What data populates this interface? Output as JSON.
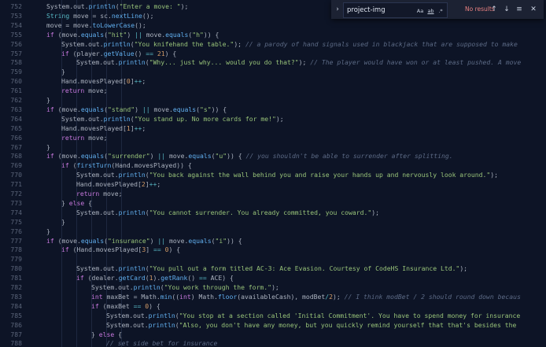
{
  "find_widget": {
    "toggle_icon": "chevron-right-icon",
    "query": "project-img",
    "options": [
      "Aa",
      "ab",
      ".*"
    ],
    "status": "No results",
    "prev_icon": "arrow-up-icon",
    "next_icon": "arrow-down-icon",
    "selection_icon": "lines-icon",
    "close_icon": "close-icon"
  },
  "colors": {
    "background": "#0d1426",
    "keyword": "#c678dd",
    "string": "#98c379",
    "comment": "#5c6a85",
    "number": "#d19a66",
    "function": "#61afef",
    "variable": "#e06c75",
    "type": "#56b6c2"
  },
  "lines": [
    {
      "n": "752",
      "indent": 2,
      "tokens": [
        [
          "p",
          "System.out."
        ],
        [
          "f",
          "println"
        ],
        [
          "p",
          "("
        ],
        [
          "s",
          "\"Enter a move: \""
        ],
        [
          "p",
          ");"
        ]
      ]
    },
    {
      "n": "753",
      "indent": 2,
      "tokens": [
        [
          "t",
          "String"
        ],
        [
          "p",
          " move = sc."
        ],
        [
          "f",
          "nextLine"
        ],
        [
          "p",
          "();"
        ]
      ]
    },
    {
      "n": "754",
      "indent": 2,
      "tokens": [
        [
          "p",
          "move = move."
        ],
        [
          "f",
          "toLowerCase"
        ],
        [
          "p",
          "();"
        ]
      ]
    },
    {
      "n": "755",
      "indent": 2,
      "tokens": [
        [
          "k",
          "if"
        ],
        [
          "p",
          " (move."
        ],
        [
          "f",
          "equals"
        ],
        [
          "p",
          "("
        ],
        [
          "s",
          "\"hit\""
        ],
        [
          "p",
          ") "
        ],
        [
          "o",
          "||"
        ],
        [
          "p",
          " move."
        ],
        [
          "f",
          "equals"
        ],
        [
          "p",
          "("
        ],
        [
          "s",
          "\"h\""
        ],
        [
          "p",
          ")) {"
        ]
      ]
    },
    {
      "n": "756",
      "indent": 3,
      "tokens": [
        [
          "p",
          "System.out."
        ],
        [
          "f",
          "println"
        ],
        [
          "p",
          "("
        ],
        [
          "s",
          "\"You knifehand the table.\""
        ],
        [
          "p",
          "); "
        ],
        [
          "c",
          "// a parody of hand signals used in blackjack that are supposed to make"
        ]
      ]
    },
    {
      "n": "757",
      "indent": 3,
      "tokens": [
        [
          "k",
          "if"
        ],
        [
          "p",
          " (player."
        ],
        [
          "f",
          "getValue"
        ],
        [
          "p",
          "() "
        ],
        [
          "o",
          "=="
        ],
        [
          "p",
          " "
        ],
        [
          "n",
          "21"
        ],
        [
          "p",
          ") {"
        ]
      ]
    },
    {
      "n": "758",
      "indent": 4,
      "tokens": [
        [
          "p",
          "System.out."
        ],
        [
          "f",
          "println"
        ],
        [
          "p",
          "("
        ],
        [
          "s",
          "\"Why... just why... would you do that?\""
        ],
        [
          "p",
          "); "
        ],
        [
          "c",
          "// The player would have won or at least pushed. A move"
        ]
      ]
    },
    {
      "n": "759",
      "indent": 3,
      "tokens": [
        [
          "p",
          "}"
        ]
      ]
    },
    {
      "n": "760",
      "indent": 3,
      "tokens": [
        [
          "p",
          "Hand.movesPlayed["
        ],
        [
          "n",
          "0"
        ],
        [
          "p",
          "]"
        ],
        [
          "o",
          "++"
        ],
        [
          "p",
          ";"
        ]
      ]
    },
    {
      "n": "761",
      "indent": 3,
      "tokens": [
        [
          "k",
          "return"
        ],
        [
          "p",
          " move;"
        ]
      ]
    },
    {
      "n": "762",
      "indent": 2,
      "tokens": [
        [
          "p",
          "}"
        ]
      ]
    },
    {
      "n": "763",
      "indent": 2,
      "tokens": [
        [
          "k",
          "if"
        ],
        [
          "p",
          " (move."
        ],
        [
          "f",
          "equals"
        ],
        [
          "p",
          "("
        ],
        [
          "s",
          "\"stand\""
        ],
        [
          "p",
          ") "
        ],
        [
          "o",
          "||"
        ],
        [
          "p",
          " move."
        ],
        [
          "f",
          "equals"
        ],
        [
          "p",
          "("
        ],
        [
          "s",
          "\"s\""
        ],
        [
          "p",
          ")) {"
        ]
      ]
    },
    {
      "n": "764",
      "indent": 3,
      "tokens": [
        [
          "p",
          "System.out."
        ],
        [
          "f",
          "println"
        ],
        [
          "p",
          "("
        ],
        [
          "s",
          "\"You stand up. No more cards for me!\""
        ],
        [
          "p",
          ");"
        ]
      ]
    },
    {
      "n": "765",
      "indent": 3,
      "tokens": [
        [
          "p",
          "Hand.movesPlayed["
        ],
        [
          "n",
          "1"
        ],
        [
          "p",
          "]"
        ],
        [
          "o",
          "++"
        ],
        [
          "p",
          ";"
        ]
      ]
    },
    {
      "n": "766",
      "indent": 3,
      "tokens": [
        [
          "k",
          "return"
        ],
        [
          "p",
          " move;"
        ]
      ]
    },
    {
      "n": "767",
      "indent": 2,
      "tokens": [
        [
          "p",
          "}"
        ]
      ]
    },
    {
      "n": "768",
      "indent": 2,
      "tokens": [
        [
          "k",
          "if"
        ],
        [
          "p",
          " (move."
        ],
        [
          "f",
          "equals"
        ],
        [
          "p",
          "("
        ],
        [
          "s",
          "\"surrender\""
        ],
        [
          "p",
          ") "
        ],
        [
          "o",
          "||"
        ],
        [
          "p",
          " move."
        ],
        [
          "f",
          "equals"
        ],
        [
          "p",
          "("
        ],
        [
          "s",
          "\"u\""
        ],
        [
          "p",
          ")) { "
        ],
        [
          "c",
          "// you shouldn't be able to surrender after splitting."
        ]
      ]
    },
    {
      "n": "769",
      "indent": 3,
      "tokens": [
        [
          "k",
          "if"
        ],
        [
          "p",
          " ("
        ],
        [
          "f",
          "firstTurn"
        ],
        [
          "p",
          "(Hand.movesPlayed)) {"
        ]
      ]
    },
    {
      "n": "770",
      "indent": 4,
      "tokens": [
        [
          "p",
          "System.out."
        ],
        [
          "f",
          "println"
        ],
        [
          "p",
          "("
        ],
        [
          "s",
          "\"You back against the wall behind you and raise your hands up and nervously look around.\""
        ],
        [
          "p",
          ");"
        ]
      ]
    },
    {
      "n": "771",
      "indent": 4,
      "tokens": [
        [
          "p",
          "Hand.movesPlayed["
        ],
        [
          "n",
          "2"
        ],
        [
          "p",
          "]"
        ],
        [
          "o",
          "++"
        ],
        [
          "p",
          ";"
        ]
      ]
    },
    {
      "n": "772",
      "indent": 4,
      "tokens": [
        [
          "k",
          "return"
        ],
        [
          "p",
          " move;"
        ]
      ]
    },
    {
      "n": "773",
      "indent": 3,
      "tokens": [
        [
          "p",
          "} "
        ],
        [
          "k",
          "else"
        ],
        [
          "p",
          " {"
        ]
      ]
    },
    {
      "n": "774",
      "indent": 4,
      "tokens": [
        [
          "p",
          "System.out."
        ],
        [
          "f",
          "println"
        ],
        [
          "p",
          "("
        ],
        [
          "s",
          "\"You cannot surrender. You already committed, you coward.\""
        ],
        [
          "p",
          ");"
        ]
      ]
    },
    {
      "n": "775",
      "indent": 3,
      "tokens": [
        [
          "p",
          "}"
        ]
      ]
    },
    {
      "n": "776",
      "indent": 2,
      "tokens": [
        [
          "p",
          "}"
        ]
      ]
    },
    {
      "n": "777",
      "indent": 2,
      "tokens": [
        [
          "k",
          "if"
        ],
        [
          "p",
          " (move."
        ],
        [
          "f",
          "equals"
        ],
        [
          "p",
          "("
        ],
        [
          "s",
          "\"insurance\""
        ],
        [
          "p",
          ") "
        ],
        [
          "o",
          "||"
        ],
        [
          "p",
          " move."
        ],
        [
          "f",
          "equals"
        ],
        [
          "p",
          "("
        ],
        [
          "s",
          "\"i\""
        ],
        [
          "p",
          ")) {"
        ]
      ]
    },
    {
      "n": "778",
      "indent": 3,
      "tokens": [
        [
          "k",
          "if"
        ],
        [
          "p",
          " (Hand.movesPlayed["
        ],
        [
          "n",
          "3"
        ],
        [
          "p",
          "] "
        ],
        [
          "o",
          "=="
        ],
        [
          "p",
          " "
        ],
        [
          "n",
          "0"
        ],
        [
          "p",
          ") {"
        ]
      ]
    },
    {
      "n": "779",
      "indent": 3,
      "tokens": []
    },
    {
      "n": "780",
      "indent": 4,
      "tokens": [
        [
          "p",
          "System.out."
        ],
        [
          "f",
          "println"
        ],
        [
          "p",
          "("
        ],
        [
          "s",
          "\"You pull out a form titled AC-3: Ace Evasion. Courtesy of CodeHS Insurance Ltd.\""
        ],
        [
          "p",
          ");"
        ]
      ]
    },
    {
      "n": "781",
      "indent": 4,
      "tokens": [
        [
          "k",
          "if"
        ],
        [
          "p",
          " (dealer."
        ],
        [
          "f",
          "getCard"
        ],
        [
          "p",
          "("
        ],
        [
          "n",
          "1"
        ],
        [
          "p",
          ")."
        ],
        [
          "f",
          "getRank"
        ],
        [
          "p",
          "() "
        ],
        [
          "o",
          "=="
        ],
        [
          "p",
          " ACE) {"
        ]
      ]
    },
    {
      "n": "782",
      "indent": 5,
      "tokens": [
        [
          "p",
          "System.out."
        ],
        [
          "f",
          "println"
        ],
        [
          "p",
          "("
        ],
        [
          "s",
          "\"You work through the form.\""
        ],
        [
          "p",
          ");"
        ]
      ]
    },
    {
      "n": "783",
      "indent": 5,
      "tokens": [
        [
          "k",
          "int"
        ],
        [
          "p",
          " maxBet = Math."
        ],
        [
          "f",
          "min"
        ],
        [
          "p",
          "(("
        ],
        [
          "k",
          "int"
        ],
        [
          "p",
          ") Math."
        ],
        [
          "f",
          "floor"
        ],
        [
          "p",
          "(availableCash), modBet"
        ],
        [
          "o",
          "/"
        ],
        [
          "n",
          "2"
        ],
        [
          "p",
          "); "
        ],
        [
          "c",
          "// I think modBet / 2 should round down becaus"
        ]
      ]
    },
    {
      "n": "784",
      "indent": 5,
      "tokens": [
        [
          "k",
          "if"
        ],
        [
          "p",
          " (maxBet "
        ],
        [
          "o",
          "=="
        ],
        [
          "p",
          " "
        ],
        [
          "n",
          "0"
        ],
        [
          "p",
          ") {"
        ]
      ]
    },
    {
      "n": "785",
      "indent": 6,
      "tokens": [
        [
          "p",
          "System.out."
        ],
        [
          "f",
          "println"
        ],
        [
          "p",
          "("
        ],
        [
          "s",
          "\"You stop at a section called 'Initial Commitment'. You have to spend money for insurance"
        ]
      ]
    },
    {
      "n": "786",
      "indent": 6,
      "tokens": [
        [
          "p",
          "System.out."
        ],
        [
          "f",
          "println"
        ],
        [
          "p",
          "("
        ],
        [
          "s",
          "\"Also, you don't have any money, but you quickly remind yourself that that's besides the"
        ]
      ]
    },
    {
      "n": "787",
      "indent": 5,
      "tokens": [
        [
          "p",
          "} "
        ],
        [
          "k",
          "else"
        ],
        [
          "p",
          " {"
        ]
      ]
    },
    {
      "n": "788",
      "indent": 6,
      "tokens": [
        [
          "c",
          "// set side bet for insurance"
        ]
      ]
    }
  ]
}
